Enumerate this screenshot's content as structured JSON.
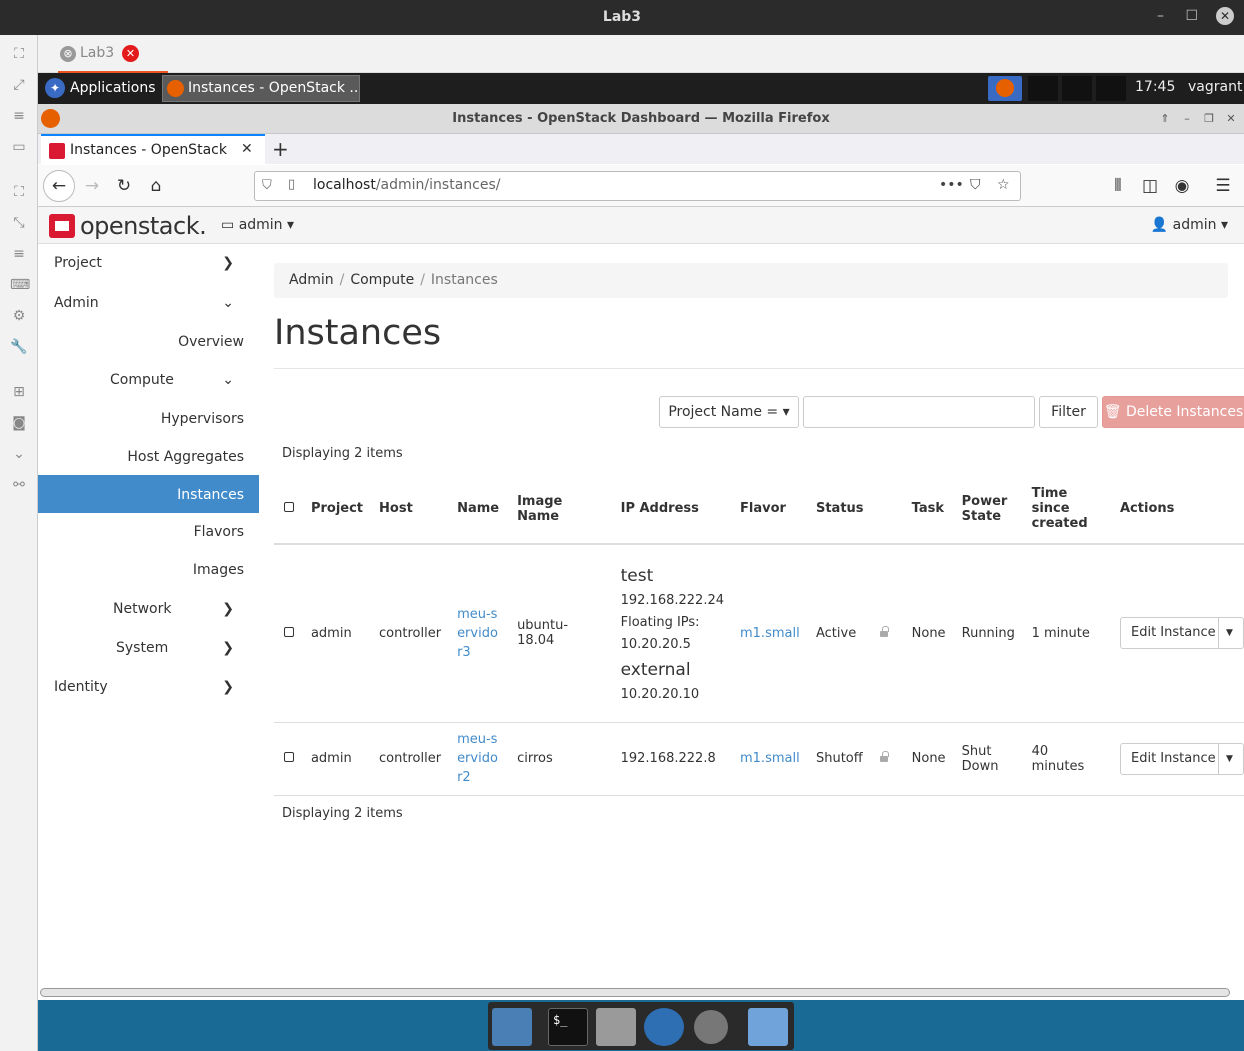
{
  "window": {
    "title": "Lab3"
  },
  "viewer_tab": {
    "label": "Lab3"
  },
  "panel": {
    "applications": "Applications",
    "task_label": "Instances - OpenStack ...",
    "clock": "17:45",
    "user": "vagrant"
  },
  "firefox": {
    "window_title": "Instances - OpenStack Dashboard — Mozilla Firefox",
    "tab_title": "Instances - OpenStack D",
    "url_host": "localhost",
    "url_path": "/admin/instances/"
  },
  "openstack": {
    "logo": "openstack.",
    "project_menu": "admin",
    "user_menu": "admin"
  },
  "sidebar": {
    "project": "Project",
    "admin": "Admin",
    "overview": "Overview",
    "compute": "Compute",
    "hypervisors": "Hypervisors",
    "host_aggregates": "Host Aggregates",
    "instances": "Instances",
    "flavors": "Flavors",
    "images": "Images",
    "network": "Network",
    "system": "System",
    "identity": "Identity"
  },
  "breadcrumb": {
    "admin": "Admin",
    "compute": "Compute",
    "current": "Instances"
  },
  "page": {
    "title": "Instances",
    "filter_field": "Project Name =",
    "filter_button": "Filter",
    "delete_button": "Delete Instances",
    "displaying": "Displaying 2 items"
  },
  "table": {
    "headers": {
      "project": "Project",
      "host": "Host",
      "name": "Name",
      "image_name": "Image Name",
      "ip_address": "IP Address",
      "flavor": "Flavor",
      "status": "Status",
      "task": "Task",
      "power_state": "Power State",
      "time_since_created": "Time since created",
      "actions": "Actions"
    },
    "rows": [
      {
        "project": "admin",
        "host": "controller",
        "name": "meu-servidor3",
        "image": "ubuntu-18.04",
        "net1": "test",
        "ip1": "192.168.222.24",
        "floating_label": "Floating IPs:",
        "floating_ip": "10.20.20.5",
        "net2": "external",
        "ip2": "10.20.20.10",
        "flavor": "m1.small",
        "status": "Active",
        "task": "None",
        "power": "Running",
        "age": "1 minute",
        "action": "Edit Instance"
      },
      {
        "project": "admin",
        "host": "controller",
        "name": "meu-servidor2",
        "image": "cirros",
        "ip1": "192.168.222.8",
        "flavor": "m1.small",
        "status": "Shutoff",
        "task": "None",
        "power": "Shut Down",
        "age": "40 minutes",
        "action": "Edit Instance"
      }
    ]
  }
}
